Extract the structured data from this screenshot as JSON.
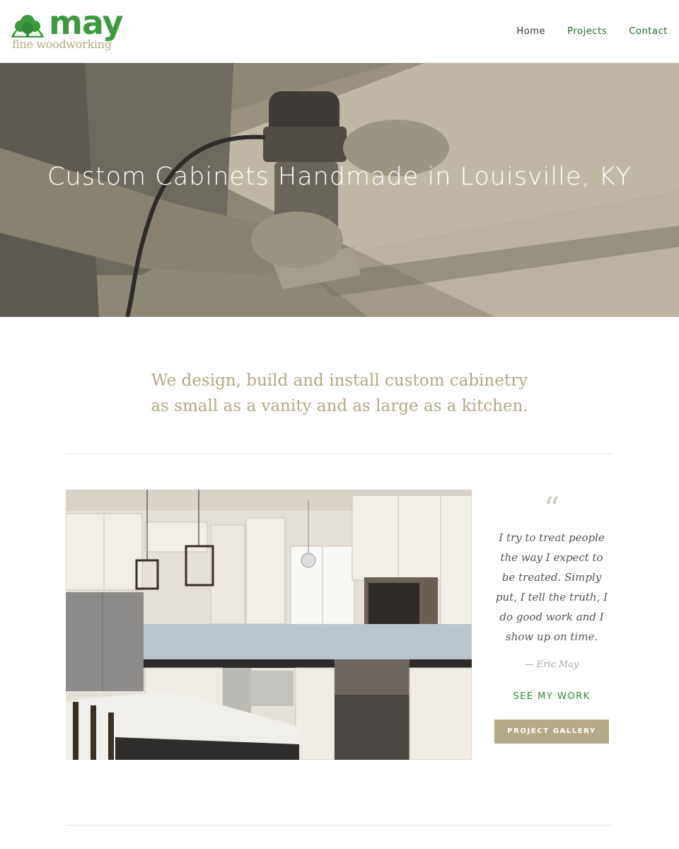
{
  "brand": {
    "name": "may",
    "tagline": "fine woodworking",
    "color_primary": "#3a9a3c",
    "color_tan": "#b5aa86"
  },
  "nav": {
    "items": [
      {
        "label": "Home",
        "active": true
      },
      {
        "label": "Projects",
        "active": false
      },
      {
        "label": "Contact",
        "active": false
      }
    ]
  },
  "hero": {
    "title": "Custom Cabinets Handmade in Louisville, KY",
    "image": "man-routing-wood-photo"
  },
  "intro": {
    "line1": "We design, build and install custom cabinetry",
    "line2": "as small as a vanity and as large as a kitchen."
  },
  "feature": {
    "image": "kitchen-photo",
    "quote_mark": "“",
    "quote": "I try to treat people the way I expect to be treated. Simply put, I tell the truth, I do good work and I show up on time.",
    "author": "— Eric May",
    "cta_link": "SEE MY WORK",
    "cta_button": "PROJECT GALLERY"
  }
}
